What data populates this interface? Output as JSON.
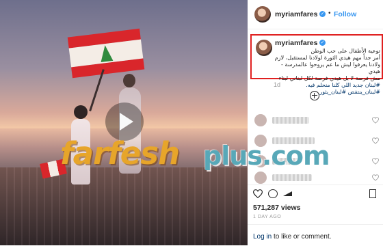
{
  "post": {
    "username": "myriamfares",
    "verified_mark": "✓",
    "separator": "•",
    "follow_label": "Follow",
    "caption_line1": "توعية الأطفال على حب الوطن",
    "caption_line2": "أمر جداً مهم هيدي الثورة لولادنا لمستقبل، لازم",
    "caption_line3": "ولادنا يعرفوا ليش ما عم يروحوا عالمدرسة - هيدي",
    "caption_line4": "مش فرصة لا بل هيدي فرصة لكل لبناني لبناء",
    "caption_hashtags": "#لبنان جديد اللي كلنا منحلم فيه. #لبنان_ينتفض #لبنان_يثور",
    "time_ago": "1d",
    "views": "571,287 views",
    "date": "1 DAY AGO",
    "login_link": "Log in",
    "login_rest": " to like or comment."
  },
  "comments": [
    {
      "blur_width": 54
    },
    {
      "blur_width": 62
    },
    {
      "blur_width": 40
    },
    {
      "blur_width": 58
    }
  ],
  "watermark": {
    "left_text": "farfesh",
    "right_text": "plus.com"
  },
  "colors": {
    "link_blue": "#3897f0",
    "hashtag_blue": "#003569",
    "highlight_red": "#e02020",
    "watermark_orange": "#e7a52a",
    "watermark_teal": "#58a8b8"
  },
  "icons": [
    "play-icon",
    "verified-icon",
    "add-comment-icon",
    "heart-icon",
    "comment-icon",
    "share-icon",
    "bookmark-icon"
  ]
}
